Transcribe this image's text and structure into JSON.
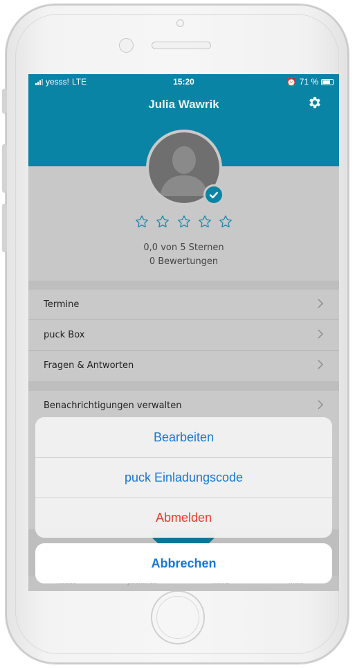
{
  "status_bar": {
    "carrier": "yesss!",
    "network": "LTE",
    "time": "15:20",
    "battery": "71 %"
  },
  "header": {
    "title": "Julia Wawrik",
    "settings_icon": "gear-icon"
  },
  "profile": {
    "avatar_icon": "user-silhouette-icon",
    "verified_icon": "checkmark-icon",
    "stars_filled": 0,
    "stars_total": 5,
    "rating_text": "0,0 von 5 Sternen",
    "reviews_text": "0 Bewertungen"
  },
  "menu_group_1": [
    {
      "label": "Termine"
    },
    {
      "label": "puck Box"
    },
    {
      "label": "Fragen & Antworten"
    }
  ],
  "menu_group_2": [
    {
      "label": "Benachrichtigungen verwalten"
    }
  ],
  "tab_bar": {
    "tabs": [
      "Neues",
      "puckst du",
      "Meins",
      "Mehr"
    ]
  },
  "action_sheet": {
    "actions": [
      {
        "label": "Bearbeiten"
      },
      {
        "label": "puck Einladungscode"
      },
      {
        "label": "Abmelden"
      }
    ],
    "cancel_label": "Abbrechen"
  },
  "colors": {
    "header": "#0a84a5",
    "action": "#1379d8",
    "destructive": "#ee3a2a"
  }
}
